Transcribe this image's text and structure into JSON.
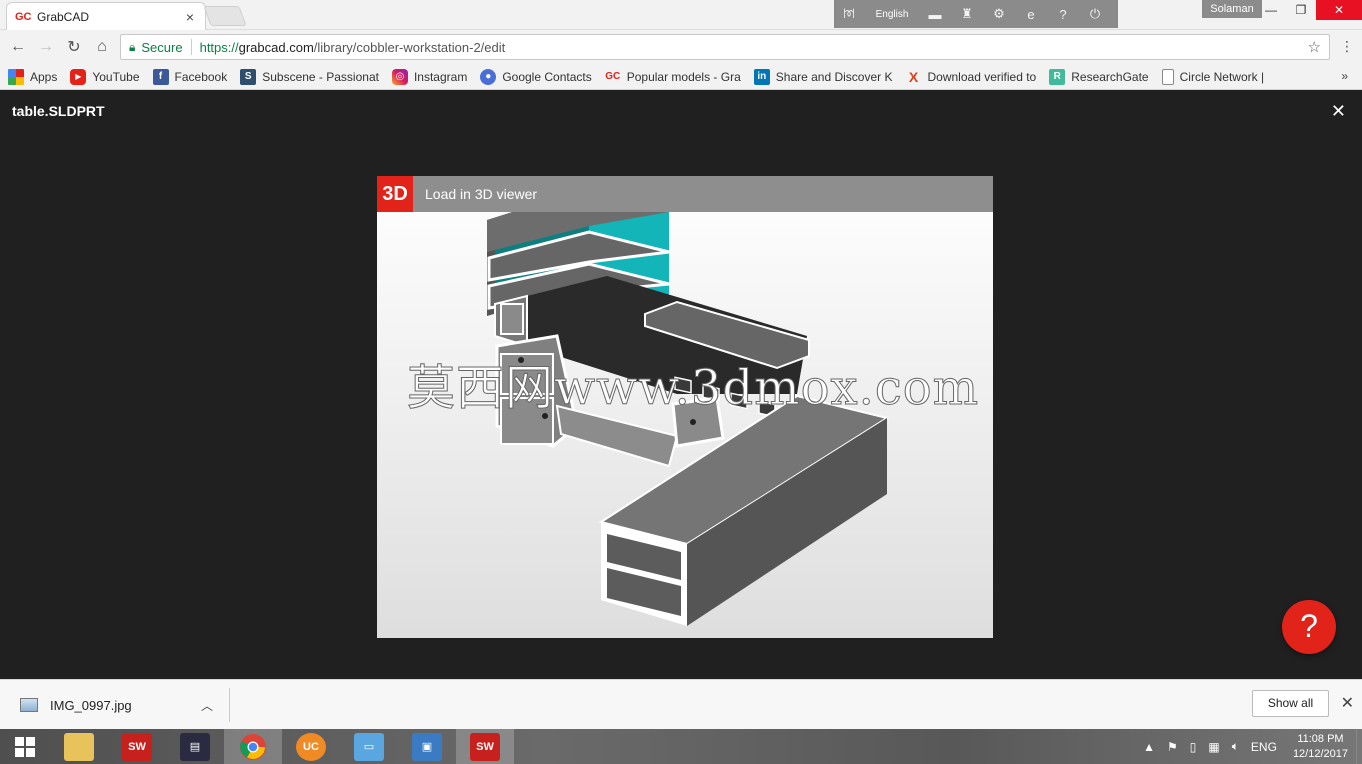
{
  "browser": {
    "tab_title": "GrabCAD",
    "tab_favicon": "GC",
    "tab_close": "×",
    "profile_name": "Solaman",
    "extension_language": "English",
    "secure_label": "Secure",
    "url_scheme": "https://",
    "url_host": "grabcad.com",
    "url_path": "/library/cobbler-workstation-2/edit",
    "window_minimize": "—",
    "window_restore": "❐",
    "window_close": "✕"
  },
  "bookmarks": [
    {
      "label": "Apps",
      "icon": "apps-grid-icon"
    },
    {
      "label": "YouTube",
      "icon": "youtube-icon"
    },
    {
      "label": "Facebook",
      "icon": "facebook-icon"
    },
    {
      "label": "Subscene - Passionat",
      "icon": "subscene-icon"
    },
    {
      "label": "Instagram",
      "icon": "instagram-icon"
    },
    {
      "label": "Google Contacts",
      "icon": "google-contacts-icon"
    },
    {
      "label": "Popular models - Gra",
      "icon": "grabcad-icon"
    },
    {
      "label": "Share and Discover K",
      "icon": "linkedin-icon"
    },
    {
      "label": "Download verified to",
      "icon": "x-icon"
    },
    {
      "label": "ResearchGate",
      "icon": "researchgate-icon"
    },
    {
      "label": "Circle Network |",
      "icon": "page-icon"
    }
  ],
  "bookmarks_more": "»",
  "viewer": {
    "filename": "table.SLDPRT",
    "close": "✕",
    "badge": "3D",
    "load_label": "Load in 3D viewer",
    "watermark": "莫西网www.3dmox.com",
    "help": "?"
  },
  "downloads": {
    "file_name": "IMG_0997.jpg",
    "show_all": "Show all",
    "close": "✕"
  },
  "taskbar": {
    "language": "ENG",
    "time": "11:08 PM",
    "date": "12/12/2017",
    "apps": [
      {
        "name": "file-explorer",
        "active": false
      },
      {
        "name": "solidworks-2016",
        "active": false
      },
      {
        "name": "dictionary-app",
        "active": false
      },
      {
        "name": "chrome",
        "active": true
      },
      {
        "name": "uc-browser",
        "active": false
      },
      {
        "name": "folder-app",
        "active": false
      },
      {
        "name": "remote-desktop",
        "active": false
      },
      {
        "name": "solidworks-2016-b",
        "active": true
      }
    ]
  },
  "colors": {
    "grabcad_red": "#e2231a",
    "secure_green": "#0b8043",
    "model_teal": "#13b5b8",
    "model_gray": "#6f6f6f"
  }
}
